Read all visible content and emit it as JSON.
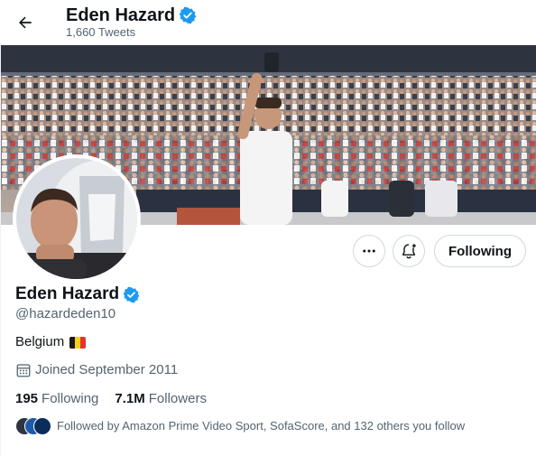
{
  "header": {
    "name": "Eden Hazard",
    "tweet_count": "1,660 Tweets"
  },
  "profile": {
    "name": "Eden Hazard",
    "handle": "@hazardeden10",
    "location": "Belgium",
    "joined": "Joined September 2011",
    "following_count": "195",
    "following_label": "Following",
    "followers_count": "7.1M",
    "followers_label": "Followers",
    "followed_by": "Followed by Amazon Prime Video Sport, SofaScore, and 132 others you follow"
  },
  "actions": {
    "following_button": "Following"
  },
  "colors": {
    "verified": "#1d9bf0",
    "text_primary": "#0f1419",
    "text_secondary": "#536471",
    "border": "#cfd9de"
  },
  "icons": [
    "back-arrow-icon",
    "verified-badge-icon",
    "more-icon",
    "notification-bell-icon",
    "calendar-icon",
    "belgium-flag-icon"
  ]
}
